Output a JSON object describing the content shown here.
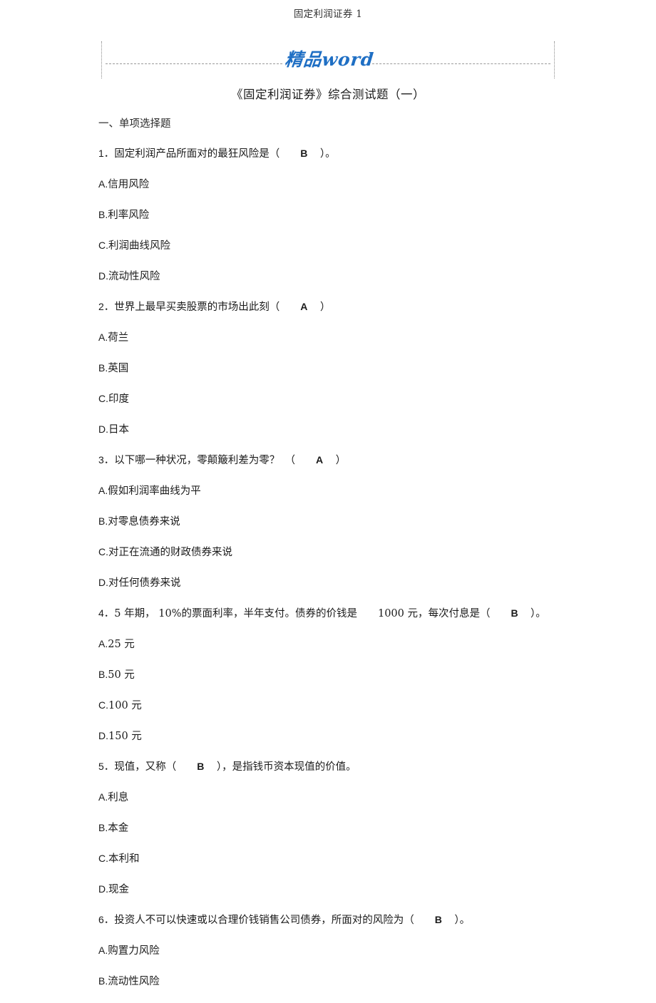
{
  "header": {
    "running_title": "固定利润证券 1"
  },
  "banner": {
    "logo_text": "精品word",
    "logo_color": "#1f6fc4"
  },
  "document": {
    "title": "《固定利润证券》综合测试题（一）",
    "section_heading": "一、单项选择题",
    "questions": [
      {
        "number": "1",
        "stem_before": "．固定利润产品所面对的最狂风险是（",
        "answer": "B",
        "stem_after": "）。",
        "options": [
          {
            "letter": "A.",
            "text": "信用风险"
          },
          {
            "letter": "B.",
            "text": "利率风险"
          },
          {
            "letter": "C.",
            "text": "利润曲线风险"
          },
          {
            "letter": "D.",
            "text": "流动性风险"
          }
        ]
      },
      {
        "number": "2",
        "stem_before": "．世界上最早买卖股票的市场出此刻（",
        "answer": "A",
        "stem_after": "）",
        "options": [
          {
            "letter": "A.",
            "text": "荷兰"
          },
          {
            "letter": "B.",
            "text": "英国"
          },
          {
            "letter": "C.",
            "text": "印度"
          },
          {
            "letter": "D.",
            "text": "日本"
          }
        ]
      },
      {
        "number": "3",
        "stem_before": "．以下哪一种状况，零颠簸利差为零？　（",
        "answer": "A",
        "stem_after": "）",
        "options": [
          {
            "letter": "A.",
            "text": "假如利润率曲线为平"
          },
          {
            "letter": "B.",
            "text": "对零息债券来说"
          },
          {
            "letter": "C.",
            "text": "对正在流通的财政债券来说"
          },
          {
            "letter": "D.",
            "text": "对任何债券来说"
          }
        ]
      },
      {
        "number": "4",
        "stem_before": "．5 年期， 10%的票面利率，半年支付。债券的价钱是　　1000 元，每次付息是（",
        "answer": "B",
        "stem_after": "）。",
        "options": [
          {
            "letter": "A.",
            "text": "25 元"
          },
          {
            "letter": "B.",
            "text": "50 元"
          },
          {
            "letter": "C.",
            "text": "100 元"
          },
          {
            "letter": "D.",
            "text": "150 元"
          }
        ]
      },
      {
        "number": "5",
        "stem_before": "．现值，又称（",
        "answer": "B",
        "stem_after": "），是指钱币资本现值的价值。",
        "options": [
          {
            "letter": "A.",
            "text": "利息"
          },
          {
            "letter": "B.",
            "text": "本金"
          },
          {
            "letter": "C.",
            "text": "本利和"
          },
          {
            "letter": "D.",
            "text": "现金"
          }
        ]
      },
      {
        "number": "6",
        "stem_before": "．投资人不可以快速或以合理价钱销售公司债券，所面对的风险为（",
        "answer": "B",
        "stem_after": "）。",
        "options": [
          {
            "letter": "A.",
            "text": "购置力风险"
          },
          {
            "letter": "B.",
            "text": "流动性风险"
          }
        ]
      }
    ]
  }
}
